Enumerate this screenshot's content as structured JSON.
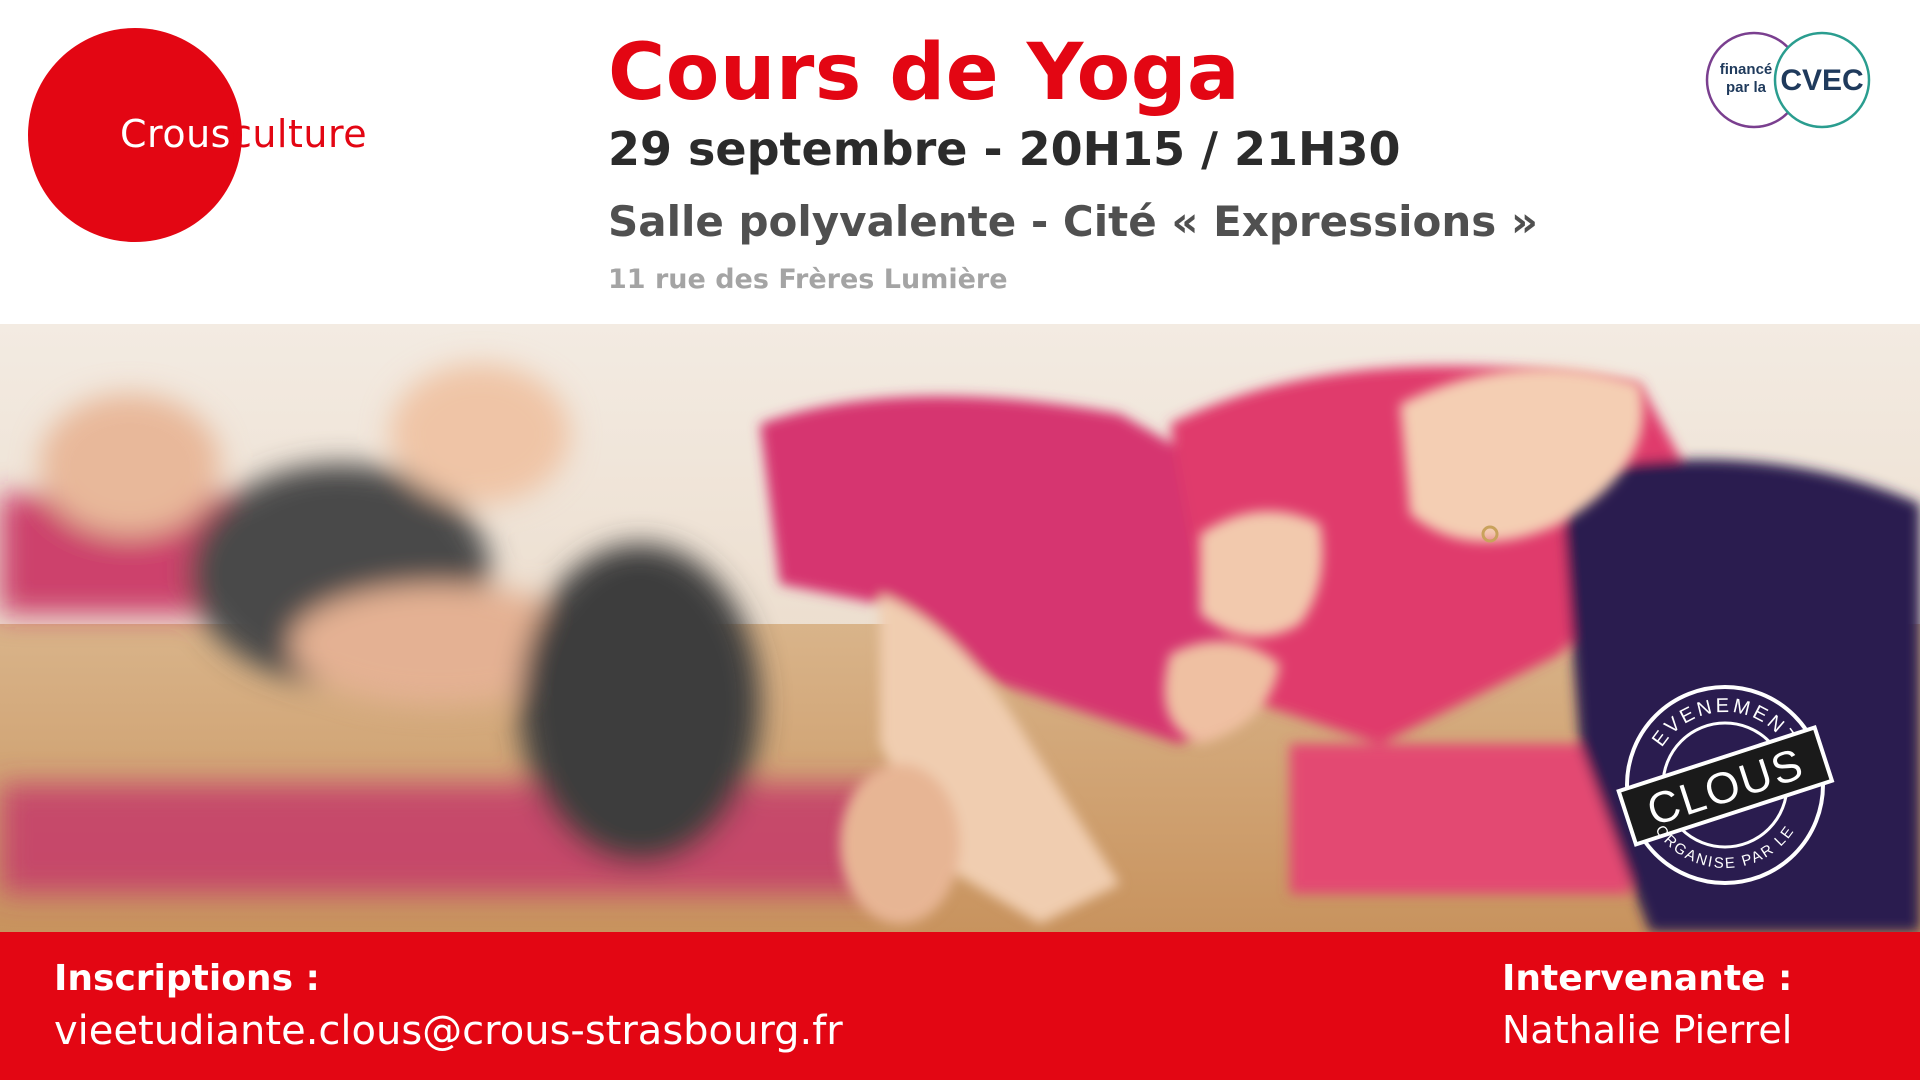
{
  "logo": {
    "crous": "Crous",
    "culture": "culture"
  },
  "event": {
    "title": "Cours de Yoga",
    "datetime": "29 septembre - 20H15 / 21H30",
    "venue": "Salle polyvalente - Cité « Expressions »",
    "address": "11 rue des Frères Lumière"
  },
  "funding_badge": {
    "line1": "financé",
    "line2": "par la",
    "brand": "CVEC"
  },
  "stamp": {
    "top_text": "EVENEMENT",
    "main_text": "CLOUS",
    "bottom_text": "ORGANISE PAR LE"
  },
  "footer": {
    "registration_label": "Inscriptions :",
    "registration_email": "vieetudiante.clous@crous-strasbourg.fr",
    "speaker_label": "Intervenante :",
    "speaker_name": "Nathalie Pierrel"
  },
  "colors": {
    "brand_red": "#e30613",
    "cvec_purple": "#7a3f8f",
    "cvec_teal": "#2a9d8f",
    "cvec_navy": "#1f3a5c"
  },
  "icons": [
    "crous-logo-circle",
    "cvec-badge-icon",
    "clous-stamp-icon",
    "yoga-photo"
  ]
}
